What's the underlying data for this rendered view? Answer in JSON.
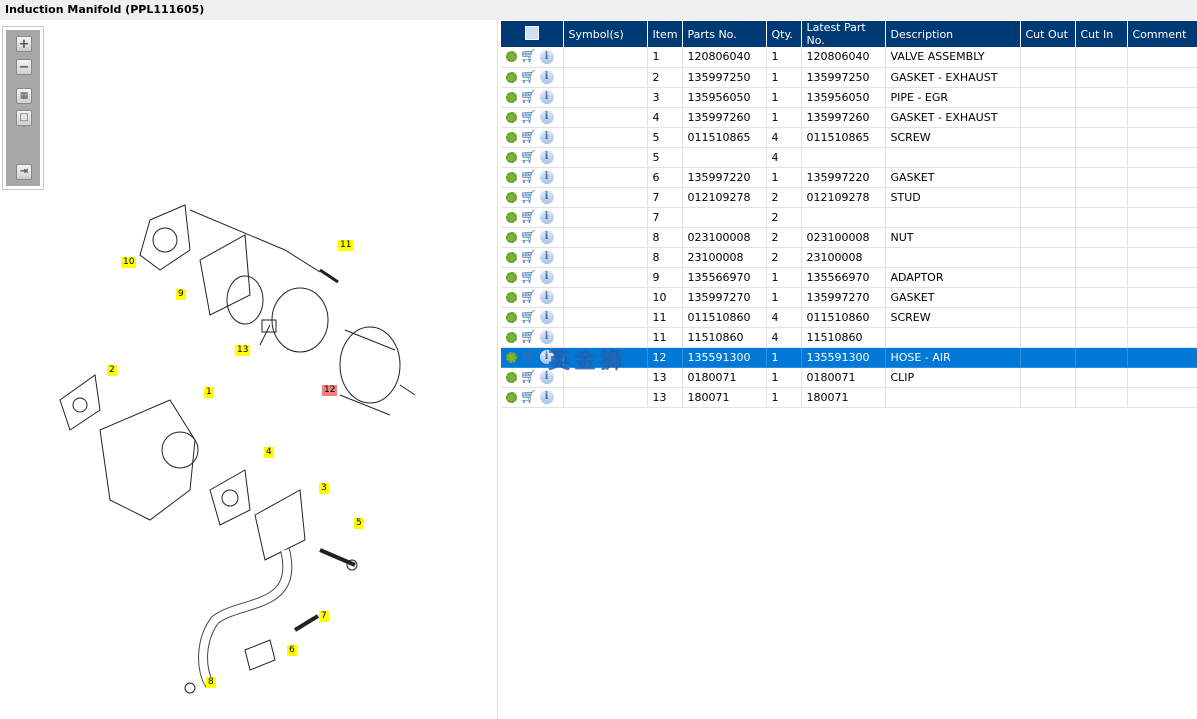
{
  "title": "Induction Manifold (PPL111605)",
  "toolbar": {
    "zoom_in": "zoom-in",
    "zoom_out": "zoom-out",
    "fit": "fit",
    "actual": "actual-size",
    "panel": "toggle-panel"
  },
  "watermark": "英金狮",
  "callouts": [
    {
      "n": "10",
      "sel": false
    },
    {
      "n": "9",
      "sel": false
    },
    {
      "n": "11",
      "sel": false
    },
    {
      "n": "13",
      "sel": false
    },
    {
      "n": "12",
      "sel": true
    },
    {
      "n": "2",
      "sel": false
    },
    {
      "n": "1",
      "sel": false
    },
    {
      "n": "4",
      "sel": false
    },
    {
      "n": "3",
      "sel": false
    },
    {
      "n": "5",
      "sel": false
    },
    {
      "n": "7",
      "sel": false
    },
    {
      "n": "6",
      "sel": false
    },
    {
      "n": "8",
      "sel": false
    }
  ],
  "table": {
    "headers": [
      "",
      "Symbol(s)",
      "Item",
      "Parts No.",
      "Qty.",
      "Latest Part No.",
      "Description",
      "Cut Out",
      "Cut In",
      "Comment"
    ],
    "rows": [
      [
        "1",
        "120806040",
        "1",
        "120806040",
        "VALVE ASSEMBLY"
      ],
      [
        "2",
        "135997250",
        "1",
        "135997250",
        "GASKET - EXHAUST"
      ],
      [
        "3",
        "135956050",
        "1",
        "135956050",
        "PIPE - EGR"
      ],
      [
        "4",
        "135997260",
        "1",
        "135997260",
        "GASKET - EXHAUST"
      ],
      [
        "5",
        "011510865",
        "4",
        "011510865",
        "SCREW"
      ],
      [
        "5",
        "",
        "4",
        "",
        ""
      ],
      [
        "6",
        "135997220",
        "1",
        "135997220",
        "GASKET"
      ],
      [
        "7",
        "012109278",
        "2",
        "012109278",
        "STUD"
      ],
      [
        "7",
        "",
        "2",
        "",
        ""
      ],
      [
        "8",
        "023100008",
        "2",
        "023100008",
        "NUT"
      ],
      [
        "8",
        "23100008",
        "2",
        "23100008",
        ""
      ],
      [
        "9",
        "135566970",
        "1",
        "135566970",
        "ADAPTOR"
      ],
      [
        "10",
        "135997270",
        "1",
        "135997270",
        "GASKET"
      ],
      [
        "11",
        "011510860",
        "4",
        "011510860",
        "SCREW"
      ],
      [
        "11",
        "11510860",
        "4",
        "11510860",
        ""
      ],
      [
        "12",
        "135591300",
        "1",
        "135591300",
        "HOSE - AIR"
      ],
      [
        "13",
        "0180071",
        "1",
        "0180071",
        "CLIP"
      ],
      [
        "13",
        "180071",
        "1",
        "180071",
        ""
      ]
    ],
    "selected_index": 15
  }
}
